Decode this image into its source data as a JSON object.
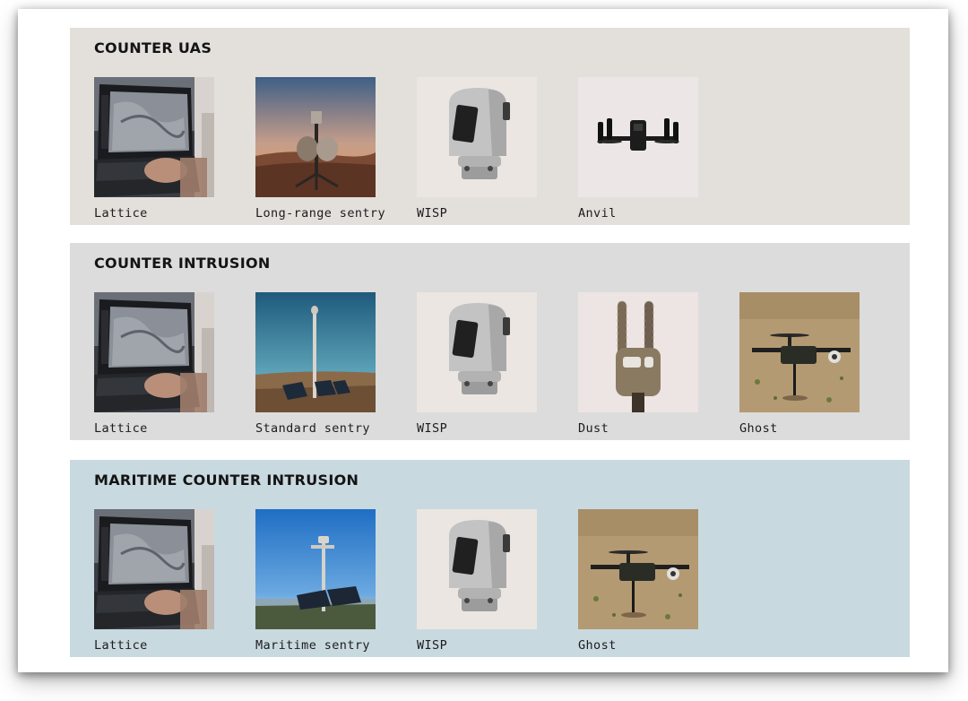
{
  "sections": [
    {
      "title": "COUNTER UAS",
      "bg": "#e3e0dc",
      "products": [
        {
          "label": "Lattice",
          "icon": "laptop-image"
        },
        {
          "label": "Long-range sentry",
          "icon": "long-range-sentry-image"
        },
        {
          "label": "WISP",
          "icon": "wisp-camera-image"
        },
        {
          "label": "Anvil",
          "icon": "anvil-drone-image"
        }
      ]
    },
    {
      "title": "COUNTER INTRUSION",
      "bg": "#dcdcdc",
      "products": [
        {
          "label": "Lattice",
          "icon": "laptop-image"
        },
        {
          "label": "Standard sentry",
          "icon": "standard-sentry-image"
        },
        {
          "label": "WISP",
          "icon": "wisp-camera-image"
        },
        {
          "label": "Dust",
          "icon": "dust-sensor-image"
        },
        {
          "label": "Ghost",
          "icon": "ghost-drone-image"
        }
      ]
    },
    {
      "title": "MARITIME COUNTER INTRUSION",
      "bg": "#c9d9e0",
      "products": [
        {
          "label": "Lattice",
          "icon": "laptop-image"
        },
        {
          "label": "Maritime sentry",
          "icon": "maritime-sentry-image"
        },
        {
          "label": "WISP",
          "icon": "wisp-camera-image"
        },
        {
          "label": "Ghost",
          "icon": "ghost-drone-image"
        }
      ]
    }
  ]
}
